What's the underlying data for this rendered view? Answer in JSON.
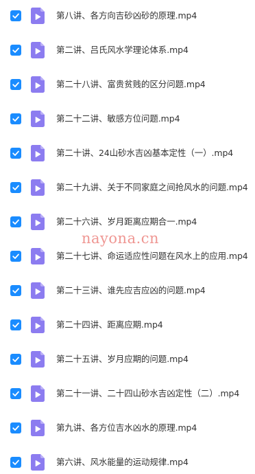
{
  "colors": {
    "checkbox": "#1a8cff",
    "file_icon": "#8c7cf0",
    "file_icon_fold": "#b9aef7",
    "text": "#333333",
    "watermark": "#eb7873"
  },
  "icons": {
    "checkbox": "check-icon",
    "file": "video-file-icon"
  },
  "files": [
    {
      "name": "第八讲、各方向吉砂凶砂的原理.mp4",
      "checked": true
    },
    {
      "name": "第二讲、吕氏风水学理论体系.mp4",
      "checked": true
    },
    {
      "name": "第二十八讲、富贵贫贱的区分问题.mp4",
      "checked": true
    },
    {
      "name": "第二十二讲、敏感方位问题.mp4",
      "checked": true
    },
    {
      "name": "第二十讲、24山砂水吉凶基本定性（一）.mp4",
      "checked": true
    },
    {
      "name": "第二十九讲、关于不同家庭之间抢风水的问题.mp4",
      "checked": true
    },
    {
      "name": "第二十六讲、岁月距离应期合一.mp4",
      "checked": true
    },
    {
      "name": "第二十七讲、命运适应性问题在风水上的应用.mp4",
      "checked": true
    },
    {
      "name": "第二十三讲、谁先应吉应凶的问题.mp4",
      "checked": true
    },
    {
      "name": "第二十四讲、距离应期.mp4",
      "checked": true
    },
    {
      "name": "第二十五讲、岁月应期的问题.mp4",
      "checked": true
    },
    {
      "name": "第二十一讲、二十四山砂水吉凶定性（二）.mp4",
      "checked": true
    },
    {
      "name": "第九讲、各方位吉水凶水的原理.mp4",
      "checked": true
    },
    {
      "name": "第六讲、风水能量的运动规律.mp4",
      "checked": true
    }
  ],
  "watermark": "nayona.cn"
}
